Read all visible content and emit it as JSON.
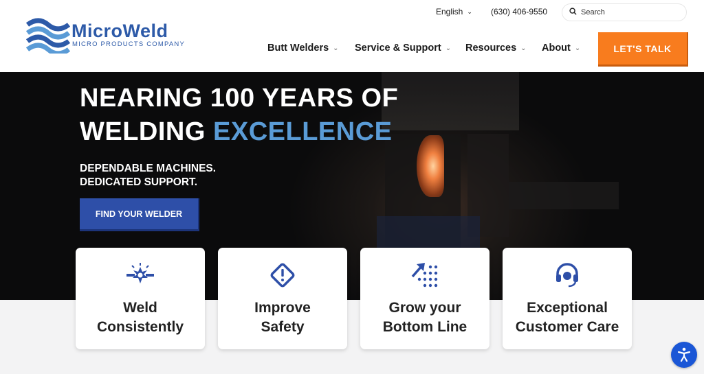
{
  "topbar": {
    "language": "English",
    "phone": "(630) 406-9550",
    "search_placeholder": "Search"
  },
  "logo": {
    "name": "MicroWeld",
    "subtitle": "MICRO PRODUCTS COMPANY"
  },
  "nav": {
    "items": [
      {
        "label": "Butt Welders"
      },
      {
        "label": "Service & Support"
      },
      {
        "label": "Resources"
      },
      {
        "label": "About"
      }
    ],
    "cta": "LET'S TALK"
  },
  "hero": {
    "headline_line1": "NEARING 100 YEARS OF",
    "headline_line2_plain": "WELDING",
    "headline_line2_accent": "EXCELLENCE",
    "tagline_line1": "DEPENDABLE MACHINES.",
    "tagline_line2": "DEDICATED SUPPORT.",
    "button": "FIND YOUR WELDER"
  },
  "cards": [
    {
      "line1": "Weld",
      "line2": "Consistently",
      "icon": "weld-spark-icon"
    },
    {
      "line1": "Improve",
      "line2": "Safety",
      "icon": "warning-diamond-icon"
    },
    {
      "line1": "Grow your",
      "line2": "Bottom Line",
      "icon": "growth-arrow-icon"
    },
    {
      "line1": "Exceptional",
      "line2": "Customer Care",
      "icon": "headset-icon"
    }
  ],
  "colors": {
    "brand_blue": "#2d5aa8",
    "accent_blue": "#5a9bd6",
    "cta_orange": "#f87c1e",
    "button_blue": "#2e4fa8"
  }
}
